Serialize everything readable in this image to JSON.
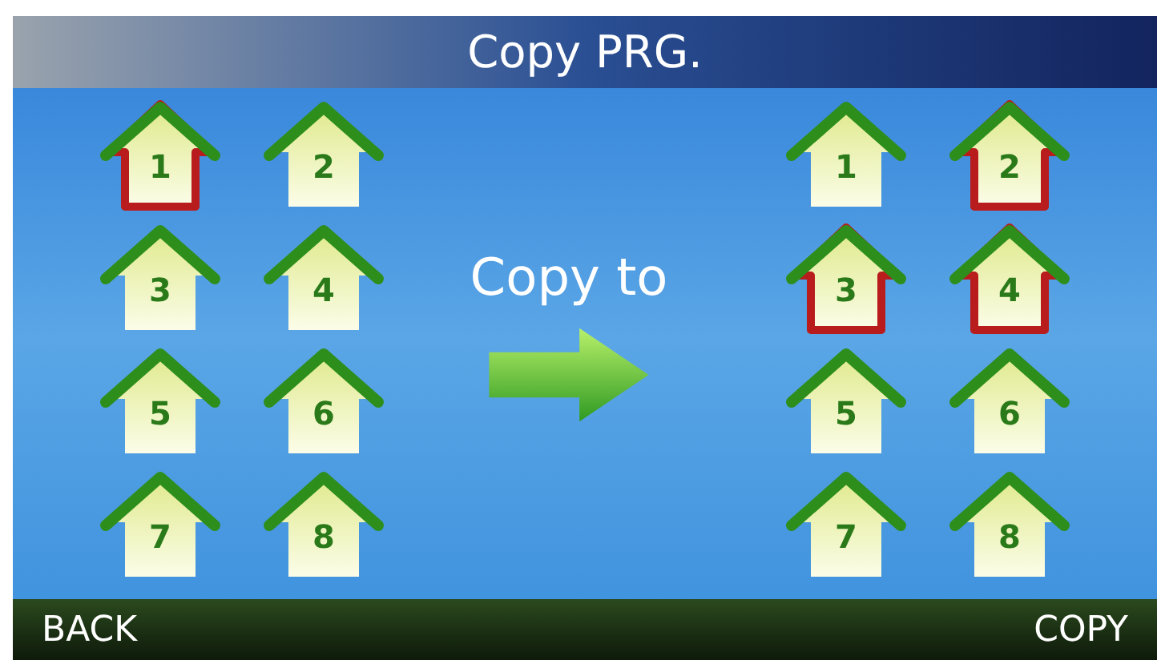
{
  "title": "Copy PRG.",
  "source_slots": [
    {
      "label": "1",
      "selected": true
    },
    {
      "label": "2",
      "selected": false
    },
    {
      "label": "3",
      "selected": false
    },
    {
      "label": "4",
      "selected": false
    },
    {
      "label": "5",
      "selected": false
    },
    {
      "label": "6",
      "selected": false
    },
    {
      "label": "7",
      "selected": false
    },
    {
      "label": "8",
      "selected": false
    }
  ],
  "copy_label": "Copy to",
  "target_slots": [
    {
      "label": "1",
      "selected": false
    },
    {
      "label": "2",
      "selected": true
    },
    {
      "label": "3",
      "selected": true
    },
    {
      "label": "4",
      "selected": true
    },
    {
      "label": "5",
      "selected": false
    },
    {
      "label": "6",
      "selected": false
    },
    {
      "label": "7",
      "selected": false
    },
    {
      "label": "8",
      "selected": false
    }
  ],
  "buttons": [
    {
      "label": "BACK"
    },
    {
      "label": "COPY"
    }
  ]
}
